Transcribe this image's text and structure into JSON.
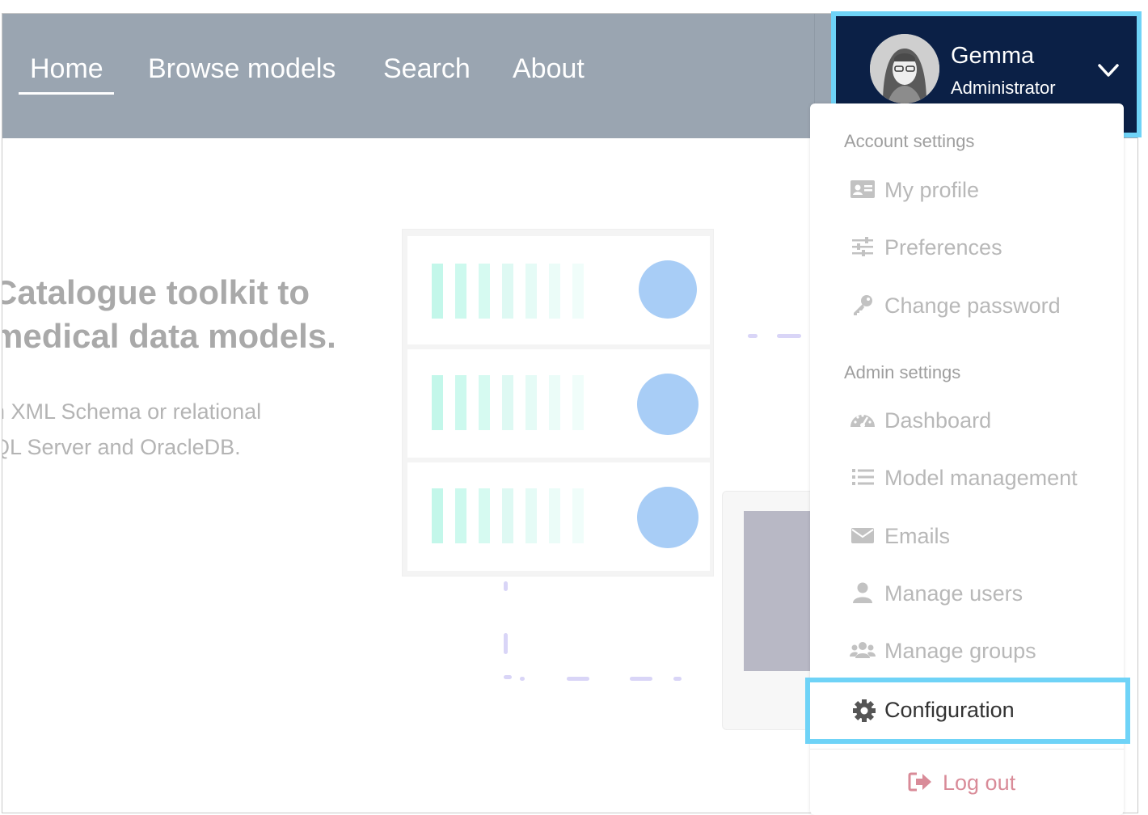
{
  "nav": {
    "links": [
      "Home",
      "Browse models",
      "Search",
      "About"
    ]
  },
  "user": {
    "name": "Gemma",
    "role": "Administrator"
  },
  "hero": {
    "title_line1": "Catalogue toolkit to",
    "title_line2": "medical data models.",
    "text_line1": "n XML Schema or relational",
    "text_line2": "QL Server and OracleDB."
  },
  "dropdown": {
    "account_label": "Account settings",
    "account_items": [
      "My profile",
      "Preferences",
      "Change password"
    ],
    "admin_label": "Admin settings",
    "admin_items": [
      "Dashboard",
      "Model management",
      "Emails",
      "Manage users",
      "Manage groups"
    ],
    "config_label": "Configuration",
    "logout_label": "Log out"
  },
  "colors": {
    "navbar": "#9aa5b1",
    "user_header": "#0b2046",
    "highlight": "#6fd3f7",
    "logout": "#d98b98"
  }
}
